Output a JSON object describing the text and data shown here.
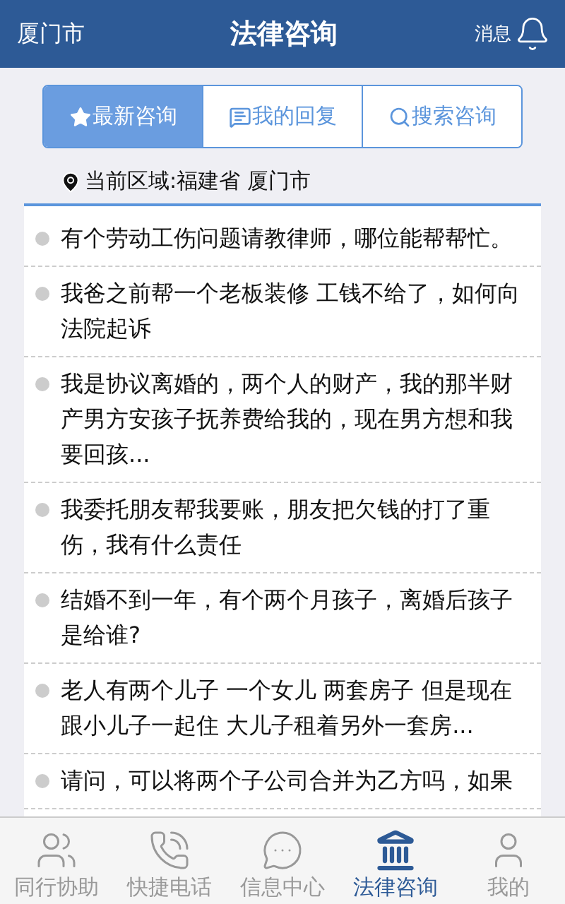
{
  "header": {
    "city": "厦门市",
    "title": "法律咨询",
    "messages": "消息"
  },
  "segments": [
    {
      "label": "最新咨询",
      "selected": true
    },
    {
      "label": "我的回复",
      "selected": false
    },
    {
      "label": "搜索咨询",
      "selected": false
    }
  ],
  "location": "当前区域:福建省 厦门市",
  "questions": [
    "有个劳动工伤问题请教律师，哪位能帮帮忙。",
    "我爸之前帮一个老板装修 工钱不给了，如何向法院起诉",
    "我是协议离婚的，两个人的财产，我的那半财产男方安孩子抚养费给我的，现在男方想和我要回孩...",
    "我委托朋友帮我要账，朋友把欠钱的打了重伤，我有什么责任",
    "结婚不到一年，有个两个月孩子，离婚后孩子是给谁?",
    "老人有两个儿子 一个女儿 两套房子 但是现在跟小儿子一起住 大儿子租着另外一套房...",
    "请问，可以将两个子公司合并为乙方吗，如果"
  ],
  "tabbar": [
    {
      "label": "同行协助",
      "selected": false
    },
    {
      "label": "快捷电话",
      "selected": false
    },
    {
      "label": "信息中心",
      "selected": false
    },
    {
      "label": "法律咨询",
      "selected": true
    },
    {
      "label": "我的",
      "selected": false
    }
  ]
}
